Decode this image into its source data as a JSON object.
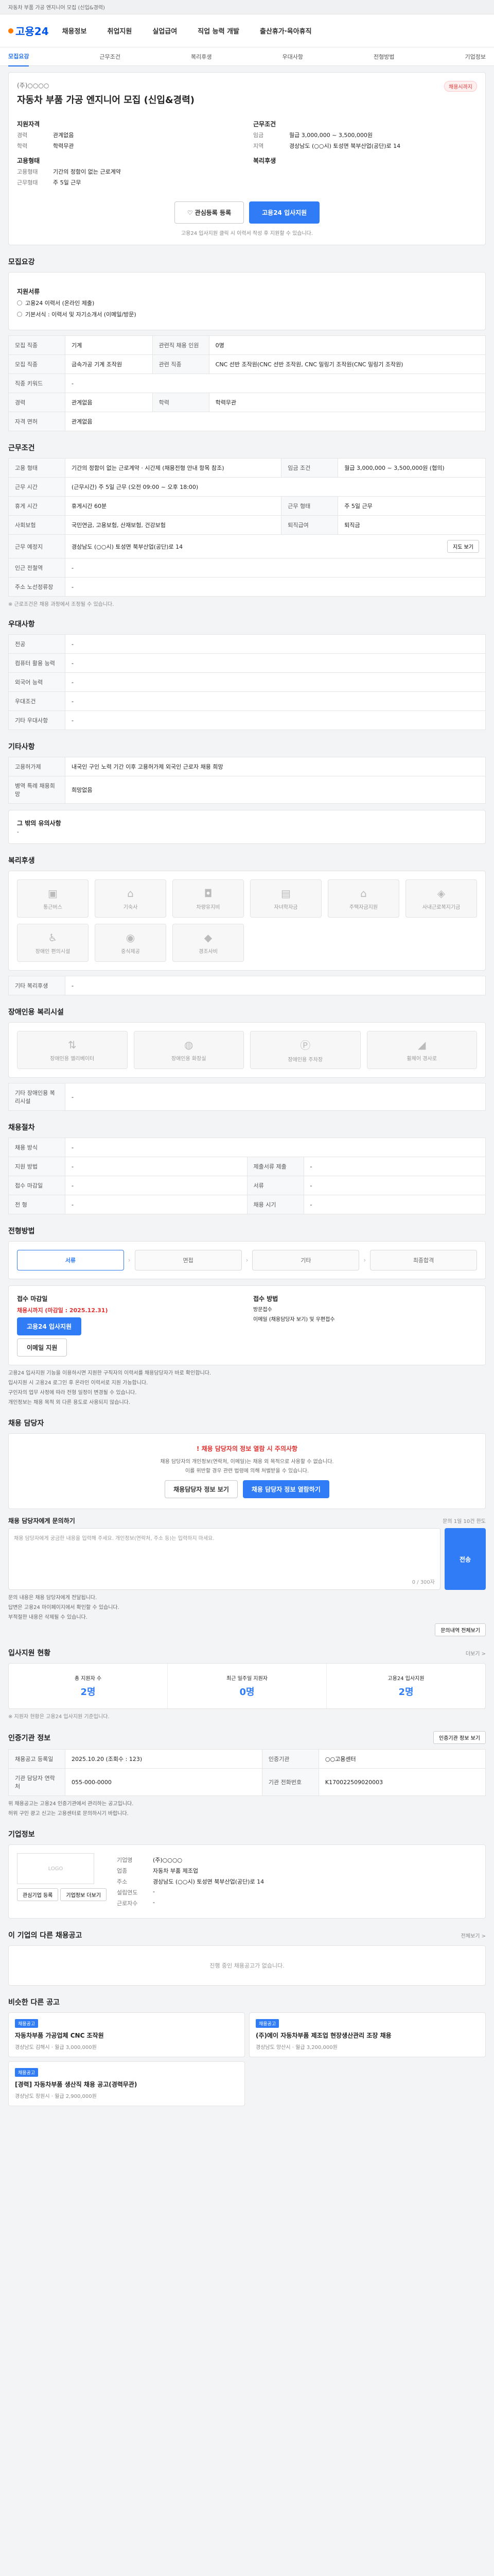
{
  "topbar": {
    "notice": "자동차 부품 가공 엔지니어 모집 (신입&경력)"
  },
  "header": {
    "logo": "고용24",
    "menu": [
      "채용정보",
      "취업지원",
      "실업급여",
      "직업 능력 개발",
      "출산휴가·육아휴직"
    ]
  },
  "subnav": [
    "모집요강",
    "근무조건",
    "복리후생",
    "우대사항",
    "전형방법",
    "기업정보"
  ],
  "job": {
    "title": "자동차 부품 가공 엔지니어 모집 (신입&경력)",
    "company": "(주)○○○○",
    "badge": "채용시까지",
    "left_head": "지원자격",
    "left": [
      {
        "k": "경력",
        "v": "관계없음"
      },
      {
        "k": "학력",
        "v": "학력무관"
      }
    ],
    "right_head": "근무조건",
    "right": [
      {
        "k": "임금",
        "v": "월급 3,000,000 ~ 3,500,000원"
      },
      {
        "k": "지역",
        "v": "경상남도 (○○시) 토성면 북부산업(공단)로 14"
      }
    ],
    "left2_head": "고용형태",
    "left2": [
      {
        "k": "고용형태",
        "v": "기간의 정함이 없는 근로계약"
      },
      {
        "k": "근무형태",
        "v": "주 5일 근무"
      }
    ],
    "right2_head": "복리후생",
    "favorite_btn": "♡ 관심등록 등록",
    "apply_btn": "고용24 입사지원",
    "note": "고용24 입사지원 클릭 시 이력서 작성 후 지원할 수 있습니다."
  },
  "recruit": {
    "title": "모집요강",
    "apply_head": "지원서류",
    "options": [
      "고용24 이력서 (온라인 제출)",
      "기본서식 : 이력서 및 자기소개서 (이메일/방문)"
    ],
    "rows": [
      [
        {
          "k": "모집 직종",
          "v": "기계"
        },
        {
          "k": "관련직 채용 인원",
          "v": "0명"
        }
      ],
      [
        {
          "k": "모집 직종",
          "v": "금속가공 기계 조작원"
        },
        {
          "k": "관련 직종",
          "v": "CNC 선반 조작원(CNC 선반 조작원, CNC 밀링기 조작원(CNC 밀링기 조작원)"
        }
      ],
      [
        {
          "k": "직종 키워드",
          "v": "-"
        },
        {
          "k": "",
          "v": ""
        }
      ],
      [
        {
          "k": "경력",
          "v": "관계없음"
        },
        {
          "k": "학력",
          "v": "학력무관"
        }
      ],
      [
        {
          "k": "자격 면허",
          "v": "관계없음"
        },
        {
          "k": "",
          "v": ""
        }
      ]
    ]
  },
  "conditions": {
    "title": "근무조건",
    "rows": [
      [
        {
          "k": "고용 형태",
          "v": "기간의 정함이 없는 근로계약 · 시간제 (채용전형 안내 항목 참조)"
        },
        {
          "k": "임금 조건",
          "v": "월급 3,000,000 ~ 3,500,000원 (협의)"
        }
      ],
      [
        {
          "k": "근무 시간",
          "v": "(근무시간) 주 5일 근무 (오전 09:00 ~ 오후 18:00)"
        },
        {
          "k": "",
          "v": ""
        }
      ],
      [
        {
          "k": "휴게 시간",
          "v": "휴게시간 60분"
        },
        {
          "k": "근무 형태",
          "v": "주 5일 근무"
        }
      ],
      [
        {
          "k": "사회보험",
          "v": "국민연금, 고용보험, 산재보험, 건강보험"
        },
        {
          "k": "퇴직급여",
          "v": "퇴직금"
        }
      ],
      [
        {
          "k": "근무 예정지",
          "v": "경상남도 (○○시) 토성면 북부산업(공단)로 14"
        },
        {
          "k": "",
          "v": ""
        }
      ],
      [
        {
          "k": "인근 전철역",
          "v": "-"
        },
        {
          "k": "",
          "v": ""
        }
      ],
      [
        {
          "k": "주소 노선정류장",
          "v": "-"
        },
        {
          "k": "",
          "v": ""
        }
      ]
    ],
    "map_btn": "지도 보기",
    "note": "※ 근로조건은 채용 과정에서 조정될 수 있습니다."
  },
  "prefer": {
    "title": "우대사항",
    "rows": [
      {
        "k": "전공",
        "v": "-"
      },
      {
        "k": "컴퓨터 활용 능력",
        "v": "-"
      },
      {
        "k": "외국어 능력",
        "v": "-"
      },
      {
        "k": "우대조건",
        "v": "-"
      },
      {
        "k": "기타 우대사항",
        "v": "-"
      }
    ]
  },
  "misc": {
    "title": "기타사항",
    "rows": [
      {
        "k": "고용허가제",
        "v": "내국인 구인 노력 기간 이후 고용허가제 외국인 근로자 채용 희망"
      },
      {
        "k": "병역 특례 채용희망",
        "v": "희망없음"
      }
    ],
    "other": "그 밖의 유의사항",
    "other_v": "-"
  },
  "welfare": {
    "title": "복리후생",
    "items": [
      "통근버스",
      "기숙사",
      "차량유지비",
      "자녀학자금",
      "주택자금지원",
      "사내근로복지기금",
      "장애인 편의시설",
      "중식제공",
      "경조사비"
    ],
    "other_k": "기타 복리후생",
    "other_v": "-"
  },
  "disability": {
    "title": "장애인용 복리시설",
    "items": [
      "장애인용 엘리베이터",
      "장애인용 화장실",
      "장애인용 주차장",
      "휠체어 경사로"
    ],
    "other_k": "기타 장애인용 복리시설",
    "other_v": "-"
  },
  "hiring": {
    "title": "채용절차",
    "rows": [
      [
        {
          "k": "채용 방식",
          "v": "-"
        },
        {
          "k": "",
          "v": ""
        }
      ],
      [
        {
          "k": "지원 방법",
          "v": "-"
        },
        {
          "k": "제출서류 제출",
          "v": "-"
        }
      ],
      [
        {
          "k": "접수 마감일",
          "v": "-"
        },
        {
          "k": "서류",
          "v": "-"
        }
      ],
      [
        {
          "k": "전 형",
          "v": "-"
        },
        {
          "k": "채용 시기",
          "v": "-"
        }
      ]
    ]
  },
  "process": {
    "title": "전형방법",
    "steps": [
      "서류",
      "면접",
      "기타",
      "최종합격"
    ],
    "apply_title": "접수 마감일",
    "deadline": "채용시까지 (마감일 : 2025.12.31)",
    "apply_btn": "고용24 입사지원",
    "visit_btn": "이메일 지원",
    "method_title": "접수 방법",
    "methods": [
      "방문접수",
      "이메일 (채용담당자 보기) 및 우편접수"
    ],
    "notes": [
      "고용24 입사지원 기능을 이용하시면 지원한 구직자의 이력서를 채용담당자가 바로 확인합니다.",
      "입사지원 시 고용24 로그인 후 온라인 이력서로 지원 가능합니다.",
      "구인자의 업무 사정에 따라 전형 일정이 변경될 수 있습니다.",
      "개인정보는 채용 목적 외 다른 용도로 사용되지 않습니다."
    ]
  },
  "manager": {
    "title": "채용 담당자",
    "alert_title": "! 채용 담당자의 정보 열람 시 주의사항",
    "alert_lines": [
      "채용 담당자의 개인정보(연락처, 이메일)는 채용 외 목적으로 사용할 수 없습니다.",
      "이를 위반할 경우 관련 법령에 의해 처벌받을 수 있습니다."
    ],
    "btn1": "채용담당자 정보 보기",
    "btn2": "채용 담당자 정보 열람하기",
    "inquiry_title": "채용 담당자에게 문의하기",
    "inquiry_limit": "문의 1일 10건 한도",
    "placeholder": "채용 담당자에게 궁금한 내용을 입력해 주세요. 개인정보(연락처, 주소 등)는 입력하지 마세요.",
    "counter": "0 / 300자",
    "submit": "전송",
    "notes": [
      "문의 내용은 채용 담당자에게 전달됩니다.",
      "답변은 고용24 마이페이지에서 확인할 수 있습니다.",
      "부적절한 내용은 삭제될 수 있습니다."
    ],
    "more_btn": "문의내역 전체보기"
  },
  "stats": {
    "title": "입사지원 현황",
    "more": "더보기 >",
    "items": [
      {
        "label": "총 지원자 수",
        "value": "2명"
      },
      {
        "label": "최근 일주일 지원자",
        "value": "0명"
      },
      {
        "label": "고용24 입사지원",
        "value": "2명"
      }
    ],
    "note": "※ 지원자 현황은 고용24 입사지원 기준입니다."
  },
  "info": {
    "title": "인증기관 정보",
    "btn": "인증기관 정보 보기",
    "rows": [
      [
        {
          "k": "채용공고 등록일",
          "v": "2025.10.20 (조회수 : 123)"
        },
        {
          "k": "인증기관",
          "v": "○○고용센터"
        }
      ],
      [
        {
          "k": "기관 담당자 연락처",
          "v": "055-000-0000"
        },
        {
          "k": "기관 전화번호",
          "v": "K170022509020003"
        }
      ]
    ],
    "notes": [
      "위 채용공고는 고용24 인증기관에서 관리하는 공고입니다.",
      "허위 구인 광고 신고는 고용센터로 문의하시기 바랍니다."
    ]
  },
  "company": {
    "title": "기업정보",
    "logo": "LOGO",
    "rows": [
      {
        "k": "기업명",
        "v": "(주)○○○○"
      },
      {
        "k": "업종",
        "v": "자동차 부품 제조업"
      },
      {
        "k": "주소",
        "v": "경상남도 (○○시) 토성면 북부산업(공단)로 14"
      },
      {
        "k": "설립연도",
        "v": "-"
      },
      {
        "k": "근로자수",
        "v": "-"
      }
    ],
    "btn1": "관심기업 등록",
    "btn2": "기업정보 더보기"
  },
  "other_jobs": {
    "title": "이 기업의 다른 채용공고",
    "more": "전체보기 >",
    "empty": "진행 중인 채용공고가 없습니다."
  },
  "similar": {
    "title": "비슷한 다른 공고",
    "items": [
      {
        "tag": "채용공고",
        "title": "자동차부품 가공업체 CNC 조작원",
        "meta": "경상남도 김해시 · 월급 3,000,000원"
      },
      {
        "tag": "채용공고",
        "title": "(주)에이 자동차부품 제조업 현장생산관리 조장 채용",
        "meta": "경상남도 양산시 · 월급 3,200,000원"
      },
      {
        "tag": "채용공고",
        "title": "[경력] 자동차부품 생산직 채용 공고(경력무관)",
        "meta": "경상남도 창원시 · 월급 2,900,000원"
      }
    ]
  }
}
